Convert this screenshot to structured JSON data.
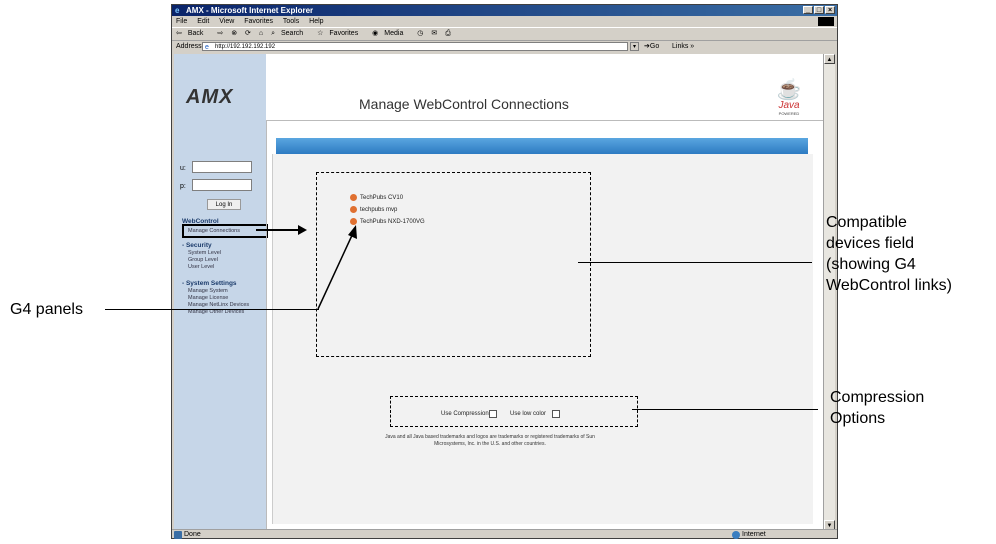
{
  "window": {
    "title": "AMX - Microsoft Internet Explorer",
    "menu": [
      "File",
      "Edit",
      "View",
      "Favorites",
      "Tools",
      "Help"
    ],
    "toolbar": [
      "Back",
      "Search",
      "Favorites",
      "Media"
    ],
    "address_label": "Address",
    "address_value": "http://192.192.192.192",
    "go_label": "Go",
    "links_label": "Links",
    "status_text": "Done",
    "status_zone": "Internet"
  },
  "page": {
    "logo": "AMX",
    "title": "Manage WebControl Connections",
    "java_logo": "Java",
    "java_powered": "POWERED"
  },
  "login": {
    "user_label": "u:",
    "pass_label": "p:",
    "button": "Log In"
  },
  "nav": {
    "web_control_section": "WebControl",
    "manage_connections": "Manage Connections",
    "security_section": "- Security",
    "security_items": [
      "System Level",
      "Group Level",
      "User Level"
    ],
    "system_settings_section": "- System Settings",
    "system_items": [
      "Manage System",
      "Manage License",
      "Manage NetLinx Devices",
      "Manage Other Devices"
    ]
  },
  "devices": [
    "TechPubs CV10",
    "techpubs mvp",
    "TechPubs NXD-1700VG"
  ],
  "options": {
    "compression": "Use Compression",
    "low_color": "Use low color"
  },
  "disclaimer": "Java and all Java based trademarks and logos are trademarks or registered trademarks of Sun Microsystems, Inc. in the U.S. and other countries.",
  "callouts": {
    "compatible_devices": [
      "Compatible",
      "devices field",
      "(showing G4",
      "WebControl links)"
    ],
    "g4_panels": "G4 panels",
    "compression_options": [
      "Compression",
      "Options"
    ]
  }
}
